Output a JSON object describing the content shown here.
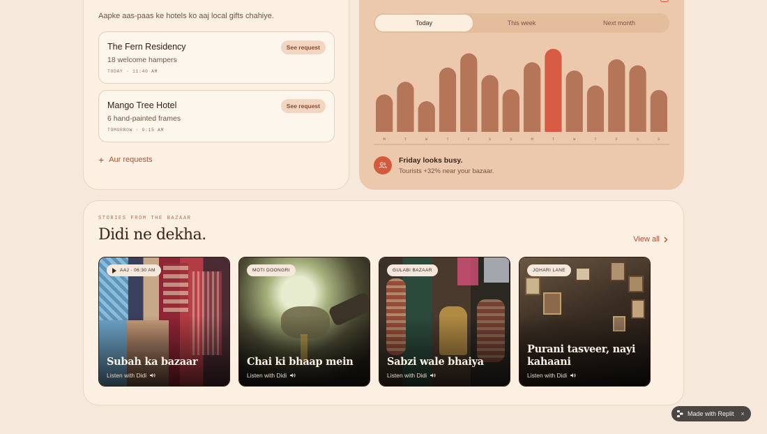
{
  "requests_card": {
    "subtitle": "Aapke aas-paas ke hotels ko aaj local gifts chahiye.",
    "requests": [
      {
        "name": "The Fern Residency",
        "detail": "18 welcome hampers",
        "time": "TODAY · 11:40 AM",
        "action": "See request"
      },
      {
        "name": "Mango Tree Hotel",
        "detail": "6 hand-painted frames",
        "time": "TOMORROW · 9:15 AM",
        "action": "See request"
      }
    ],
    "more_label": "Aur requests"
  },
  "forecast_card": {
    "tabs": [
      {
        "label": "Today",
        "active": true
      },
      {
        "label": "This week",
        "active": false
      },
      {
        "label": "Next month",
        "active": false
      }
    ],
    "alert_title": "Friday looks busy.",
    "alert_text": "Tourists +32% near your bazaar."
  },
  "chart_data": {
    "type": "bar",
    "categories": [
      "M",
      "T",
      "W",
      "T",
      "F",
      "S",
      "S",
      "M",
      "T",
      "W",
      "T",
      "F",
      "S",
      "S"
    ],
    "values": [
      50,
      67,
      41,
      86,
      105,
      76,
      57,
      93,
      111,
      82,
      62,
      97,
      89,
      56
    ],
    "highlight_index": 8,
    "colors": {
      "bar": "#b47559",
      "highlight": "#d65b42"
    },
    "grid": false
  },
  "stories": {
    "eyebrow": "STORIES FROM THE BAZAAR",
    "title": "Didi ne dekha.",
    "view_all": "View all",
    "items": [
      {
        "tag": "AAJ · 06:30 AM",
        "has_play": true,
        "title": "Subah ka bazaar",
        "listen": "Listen with Didi"
      },
      {
        "tag": "MOTI DOONGRI",
        "has_play": false,
        "title": "Chai ki bhaap mein",
        "listen": "Listen with Didi"
      },
      {
        "tag": "GULABI BAZAAR",
        "has_play": false,
        "title": "Sabzi wale bhaiya",
        "listen": "Listen with Didi"
      },
      {
        "tag": "JOHARI LANE",
        "has_play": false,
        "title": "Purani tasveer, nayi kahaani",
        "listen": "Listen with Didi"
      }
    ]
  },
  "badge": {
    "label": "Made with Replit",
    "close": "×"
  }
}
